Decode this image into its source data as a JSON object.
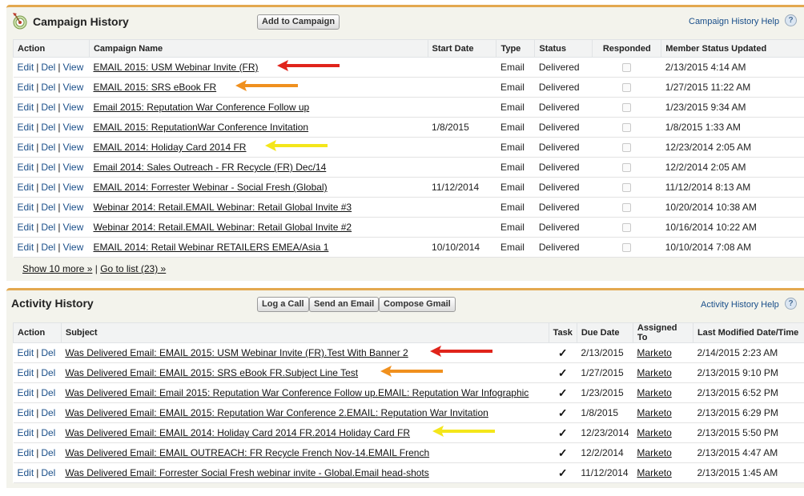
{
  "campaign_history": {
    "title": "Campaign History",
    "add_button": "Add to Campaign",
    "help_link": "Campaign History Help",
    "help_icon": "?",
    "columns": [
      "Action",
      "Campaign Name",
      "Start Date",
      "Type",
      "Status",
      "Responded",
      "Member Status Updated"
    ],
    "rows": [
      {
        "name": "EMAIL 2015: USM Webinar Invite (FR)",
        "start": "",
        "type": "Email",
        "status": "Delivered",
        "updated": "2/13/2015 4:14 AM",
        "arrow": "red"
      },
      {
        "name": "EMAIL 2015: SRS eBook FR",
        "start": "",
        "type": "Email",
        "status": "Delivered",
        "updated": "1/27/2015 11:22 AM",
        "arrow": "orange"
      },
      {
        "name": "Email 2015: Reputation War Conference Follow up",
        "start": "",
        "type": "Email",
        "status": "Delivered",
        "updated": "1/23/2015 9:34 AM",
        "arrow": ""
      },
      {
        "name": "EMAIL 2015: ReputationWar Conference Invitation",
        "start": "1/8/2015",
        "type": "Email",
        "status": "Delivered",
        "updated": "1/8/2015 1:33 AM",
        "arrow": ""
      },
      {
        "name": "EMAIL 2014: Holiday Card 2014 FR",
        "start": "",
        "type": "Email",
        "status": "Delivered",
        "updated": "12/23/2014 2:05 AM",
        "arrow": "yellow"
      },
      {
        "name": "Email 2014: Sales Outreach - FR Recycle (FR) Dec/14",
        "start": "",
        "type": "Email",
        "status": "Delivered",
        "updated": "12/2/2014 2:05 AM",
        "arrow": ""
      },
      {
        "name": "EMAIL 2014: Forrester Webinar - Social Fresh (Global)",
        "start": "11/12/2014",
        "type": "Email",
        "status": "Delivered",
        "updated": "11/12/2014 8:13 AM",
        "arrow": ""
      },
      {
        "name": "Webinar 2014: Retail.EMAIL Webinar: Retail Global Invite #3",
        "start": "",
        "type": "Email",
        "status": "Delivered",
        "updated": "10/20/2014 10:38 AM",
        "arrow": ""
      },
      {
        "name": "Webinar 2014: Retail.EMAIL Webinar: Retail Global Invite #2",
        "start": "",
        "type": "Email",
        "status": "Delivered",
        "updated": "10/16/2014 10:22 AM",
        "arrow": ""
      },
      {
        "name": "EMAIL 2014: Retail Webinar RETAILERS EMEA/Asia 1",
        "start": "10/10/2014",
        "type": "Email",
        "status": "Delivered",
        "updated": "10/10/2014 7:08 AM",
        "arrow": ""
      }
    ],
    "action_edit": "Edit",
    "action_del": "Del",
    "action_view": "View",
    "show_more": "Show 10 more »",
    "separator": "|",
    "go_to_list": "Go to list (23) »"
  },
  "activity_history": {
    "title": "Activity History",
    "buttons": [
      "Log a Call",
      "Send an Email",
      "Compose Gmail"
    ],
    "help_link": "Activity History Help",
    "help_icon": "?",
    "columns": [
      "Action",
      "Subject",
      "Task",
      "Due Date",
      "Assigned To",
      "Last Modified Date/Time"
    ],
    "rows": [
      {
        "subject": "Was Delivered Email: EMAIL 2015: USM Webinar Invite (FR).Test With Banner 2",
        "due": "2/13/2015",
        "assigned": "Marketo",
        "modified": "2/14/2015 2:23 AM",
        "arrow": "red"
      },
      {
        "subject": "Was Delivered Email: EMAIL 2015: SRS eBook FR.Subject Line Test",
        "due": "1/27/2015",
        "assigned": "Marketo",
        "modified": "2/13/2015 9:10 PM",
        "arrow": "orange"
      },
      {
        "subject": "Was Delivered Email: Email 2015: Reputation War Conference Follow up.EMAIL: Reputation War Infographic",
        "due": "1/23/2015",
        "assigned": "Marketo",
        "modified": "2/13/2015 6:52 PM",
        "arrow": ""
      },
      {
        "subject": "Was Delivered Email: EMAIL 2015: Reputation War Conference 2.EMAIL: Reputation War Invitation",
        "due": "1/8/2015",
        "assigned": "Marketo",
        "modified": "2/13/2015 6:29 PM",
        "arrow": ""
      },
      {
        "subject": "Was Delivered Email: EMAIL 2014: Holiday Card 2014 FR.2014 Holiday Card FR",
        "due": "12/23/2014",
        "assigned": "Marketo",
        "modified": "2/13/2015 5:50 PM",
        "arrow": "yellow"
      },
      {
        "subject": "Was Delivered Email: EMAIL OUTREACH: FR Recycle French Nov-14.EMAIL French",
        "due": "12/2/2014",
        "assigned": "Marketo",
        "modified": "2/13/2015 4:47 AM",
        "arrow": ""
      },
      {
        "subject": "Was Delivered Email: Forrester Social Fresh webinar invite - Global.Email head-shots",
        "due": "11/12/2014",
        "assigned": "Marketo",
        "modified": "2/13/2015 1:45 AM",
        "arrow": ""
      }
    ],
    "action_edit": "Edit",
    "action_del": "Del",
    "task_mark": "✓"
  },
  "colors": {
    "section_border": "#e3a84f",
    "link": "#1a4f8a",
    "arrow_red": "#e0241b",
    "arrow_orange": "#f0901e",
    "arrow_yellow": "#f4e61a"
  }
}
